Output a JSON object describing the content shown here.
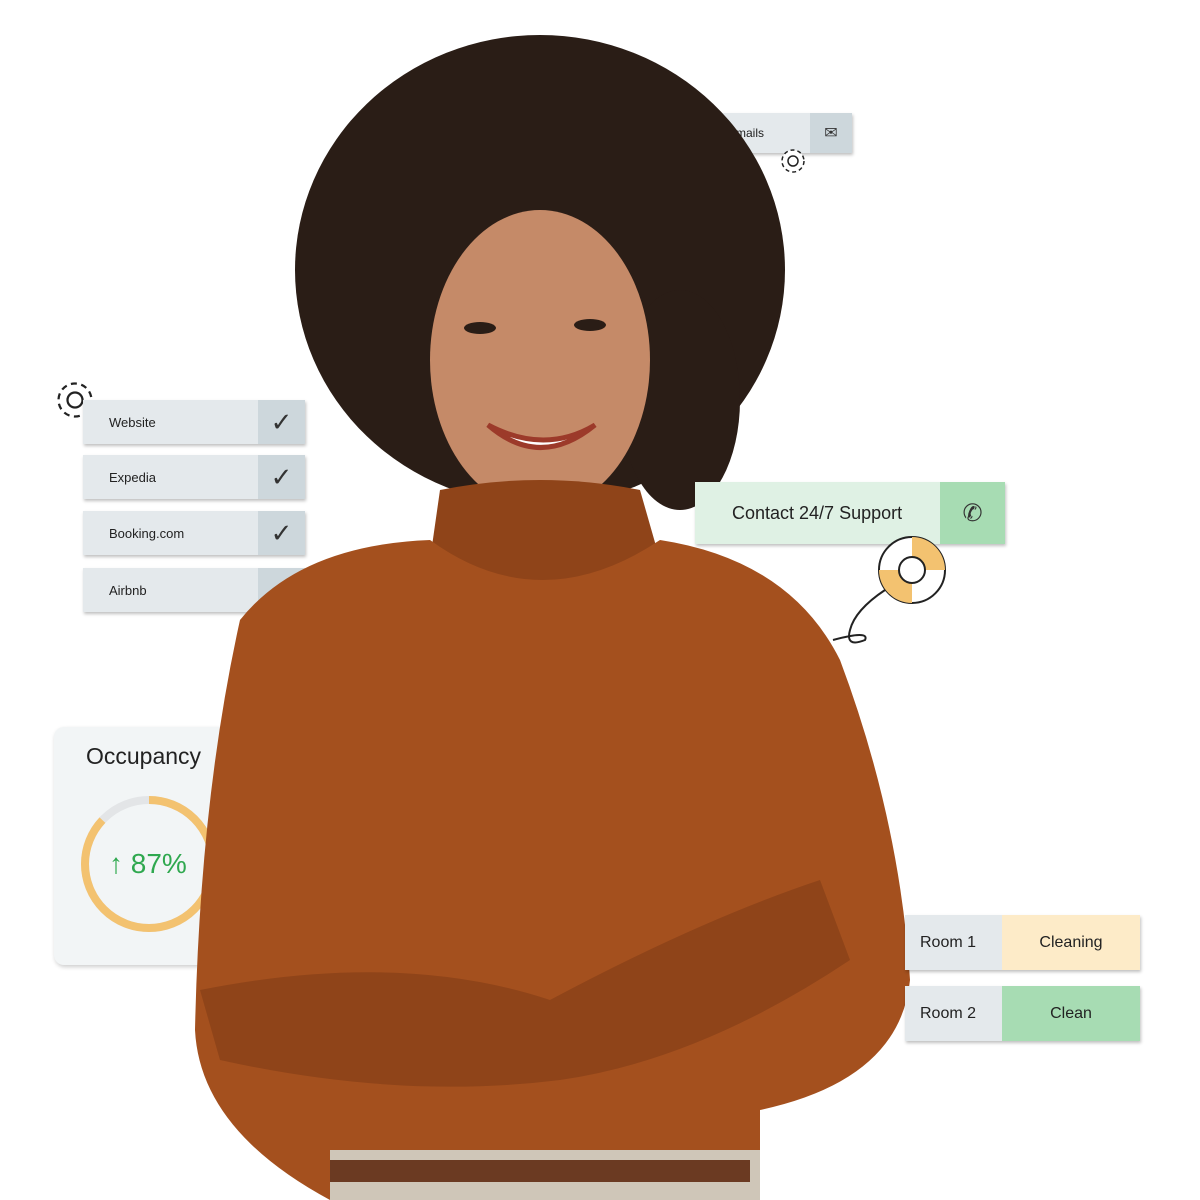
{
  "emails_card": {
    "label": "o Emails",
    "icon": "envelope-icon"
  },
  "channels": [
    {
      "label": "Website",
      "checked": true
    },
    {
      "label": "Expedia",
      "checked": true
    },
    {
      "label": "Booking.com",
      "checked": true
    },
    {
      "label": "Airbnb",
      "checked": false
    }
  ],
  "support": {
    "label": "Contact 24/7 Support",
    "icon": "phone-icon",
    "color": "#a7dcb3"
  },
  "occupancy": {
    "title": "Occupancy",
    "value": "87%",
    "arrow": "↑",
    "percent": 87,
    "ring_color": "#f3c270",
    "text_color": "#2fa84f"
  },
  "rooms": [
    {
      "label": "Room 1",
      "status": "Cleaning",
      "color": "#fdebc8"
    },
    {
      "label": "Room 2",
      "status": "Clean",
      "color": "#a7dcb3"
    }
  ]
}
